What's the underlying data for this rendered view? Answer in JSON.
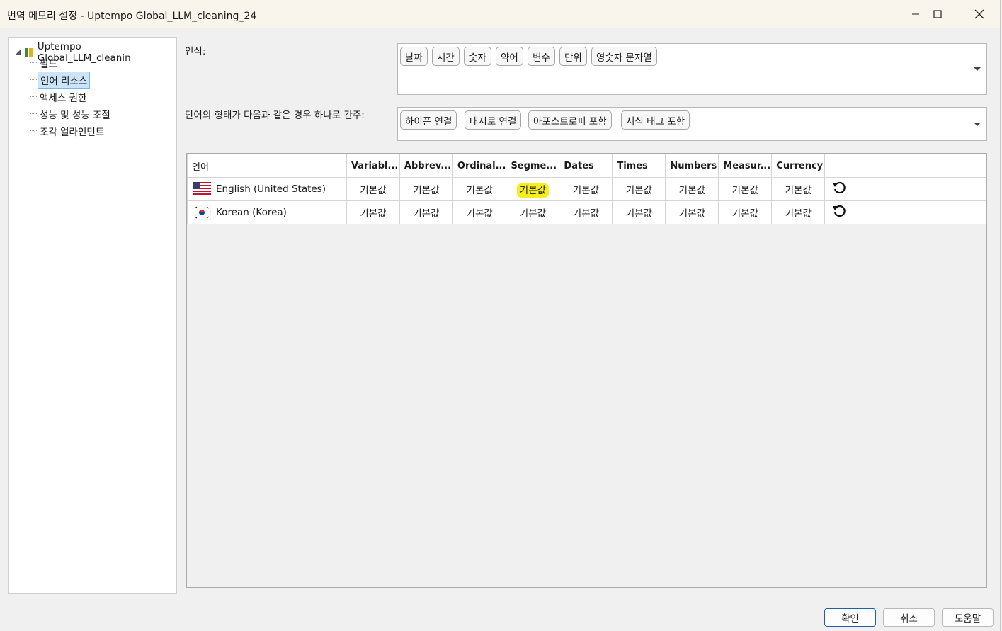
{
  "window": {
    "title": "번역 메모리 설정 - Uptempo Global_LLM_cleaning_24"
  },
  "tree": {
    "root": "Uptempo Global_LLM_cleanin",
    "items": [
      {
        "label": "필드",
        "selected": false
      },
      {
        "label": "언어 리소스",
        "selected": true
      },
      {
        "label": "액세스 권한",
        "selected": false
      },
      {
        "label": "성능 및 성능 조절",
        "selected": false
      },
      {
        "label": "조각 얼라인먼트",
        "selected": false
      }
    ]
  },
  "recognize": {
    "label": "인식:",
    "tags": [
      "날짜",
      "시간",
      "숫자",
      "약어",
      "변수",
      "단위",
      "영숫자 문자열"
    ]
  },
  "wordforms": {
    "label": "단어의 형태가 다음과 같은 경우 하나로 간주:",
    "tags": [
      "하이픈 연결",
      "대시로 연결",
      "아포스트로피 포함",
      "서식 태그 포함"
    ]
  },
  "grid": {
    "headers": [
      "언어",
      "Variabl...",
      "Abbrev...",
      "Ordinal...",
      "Segme...",
      "Dates",
      "Times",
      "Numbers",
      "Measur...",
      "Currency"
    ],
    "rows": [
      {
        "language": "English (United States)",
        "flag": "us-flag",
        "values": [
          "기본값",
          "기본값",
          "기본값",
          "기본값",
          "기본값",
          "기본값",
          "기본값",
          "기본값",
          "기본값"
        ]
      },
      {
        "language": "Korean (Korea)",
        "flag": "kr-flag",
        "values": [
          "기본값",
          "기본값",
          "기본값",
          "기본값",
          "기본값",
          "기본값",
          "기본값",
          "기본값",
          "기본값"
        ]
      }
    ]
  },
  "footer": {
    "ok": "확인",
    "cancel": "취소",
    "help": "도움말"
  },
  "colors": {
    "highlight": "#f5ee1c",
    "selection": "#cce4f7",
    "primary_border": "#1f5fad"
  }
}
